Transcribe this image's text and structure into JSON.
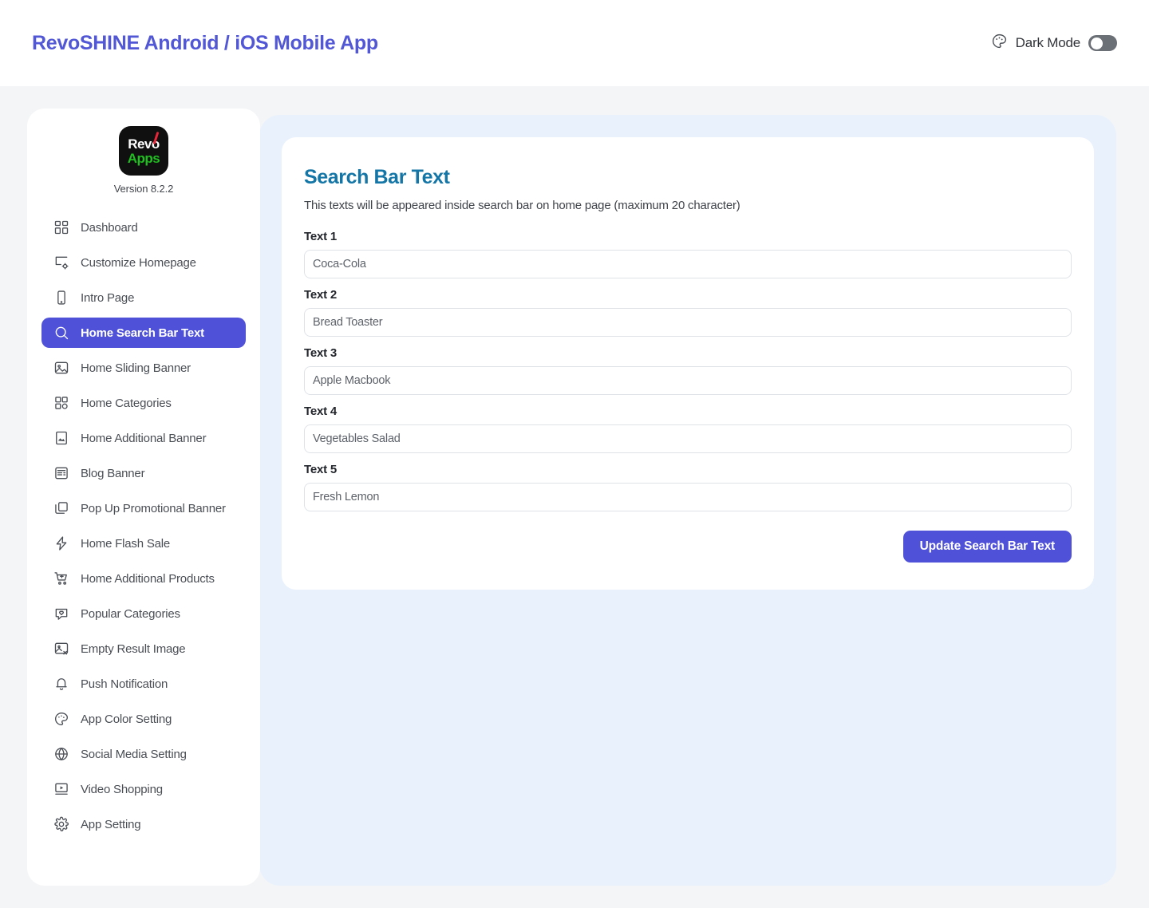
{
  "header": {
    "brand_title": "RevoSHINE Android / iOS Mobile App",
    "dark_mode_label": "Dark Mode",
    "dark_mode_enabled": false,
    "palette_icon": "palette-icon"
  },
  "sidebar": {
    "logo": {
      "line1": "Revo",
      "line2": "Apps",
      "version": "Version 8.2.2"
    },
    "items": [
      {
        "label": "Dashboard",
        "icon": "dashboard-grid-icon",
        "active": false
      },
      {
        "label": "Customize Homepage",
        "icon": "layout-settings-icon",
        "active": false
      },
      {
        "label": "Intro Page",
        "icon": "mobile-phone-icon",
        "active": false
      },
      {
        "label": "Home Search Bar Text",
        "icon": "search-icon",
        "active": true
      },
      {
        "label": "Home Sliding Banner",
        "icon": "image-icon",
        "active": false
      },
      {
        "label": "Home Categories",
        "icon": "grid-icon",
        "active": false
      },
      {
        "label": "Home Additional Banner",
        "icon": "picture-frame-icon",
        "active": false
      },
      {
        "label": "Blog Banner",
        "icon": "article-icon",
        "active": false
      },
      {
        "label": "Pop Up Promotional Banner",
        "icon": "windows-stack-icon",
        "active": false
      },
      {
        "label": "Home Flash Sale",
        "icon": "lightning-bolt-icon",
        "active": false
      },
      {
        "label": "Home Additional Products",
        "icon": "cart-plus-icon",
        "active": false
      },
      {
        "label": "Popular Categories",
        "icon": "heart-bubble-icon",
        "active": false
      },
      {
        "label": "Empty Result Image",
        "icon": "image-x-icon",
        "active": false
      },
      {
        "label": "Push Notification",
        "icon": "bell-icon",
        "active": false
      },
      {
        "label": "App Color Setting",
        "icon": "palette-icon",
        "active": false
      },
      {
        "label": "Social Media Setting",
        "icon": "globe-icon",
        "active": false
      },
      {
        "label": "Video Shopping",
        "icon": "video-play-icon",
        "active": false
      },
      {
        "label": "App Setting",
        "icon": "gear-icon",
        "active": false
      }
    ]
  },
  "main": {
    "title": "Search Bar Text",
    "description": "This texts will be appeared inside search bar on home page (maximum 20 character)",
    "fields": [
      {
        "label": "Text 1",
        "value": "Coca-Cola"
      },
      {
        "label": "Text 2",
        "value": "Bread Toaster"
      },
      {
        "label": "Text 3",
        "value": "Apple Macbook"
      },
      {
        "label": "Text 4",
        "value": "Vegetables Salad"
      },
      {
        "label": "Text 5",
        "value": "Fresh Lemon"
      }
    ],
    "submit_label": "Update Search Bar Text"
  },
  "colors": {
    "brand_indigo": "#4f52d9",
    "title_teal": "#1476a6",
    "panel_blue": "#e9f1fc",
    "page_bg": "#f4f5f7"
  }
}
